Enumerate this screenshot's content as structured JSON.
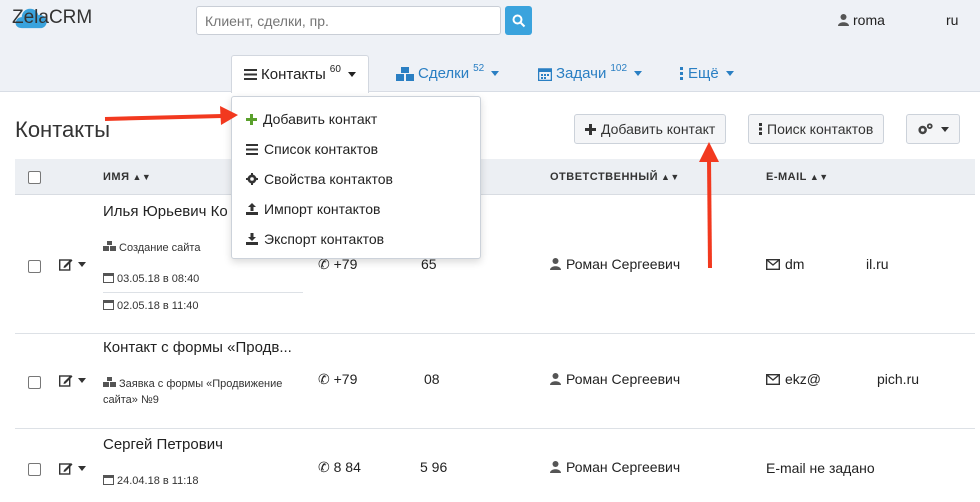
{
  "app": {
    "name": "ZelaCRM"
  },
  "search": {
    "placeholder": "Клиент, сделки, пр."
  },
  "user": {
    "name": "roma"
  },
  "lang": {
    "current": "ru"
  },
  "nav": {
    "contacts": {
      "label": "Контакты",
      "count": "60"
    },
    "deals": {
      "label": "Сделки",
      "count": "52"
    },
    "tasks": {
      "label": "Задачи",
      "count": "102"
    },
    "more": {
      "label": "Ещё"
    }
  },
  "dropdown": {
    "items": [
      {
        "label": "Добавить контакт",
        "icon": "plus-icon"
      },
      {
        "label": "Список контактов",
        "icon": "list-icon"
      },
      {
        "label": "Свойства контактов",
        "icon": "gear-icon"
      },
      {
        "label": "Импорт контактов",
        "icon": "upload-icon"
      },
      {
        "label": "Экспорт контактов",
        "icon": "download-icon"
      }
    ]
  },
  "page": {
    "title": "Контакты"
  },
  "toolbar": {
    "add_label": "Добавить контакт",
    "search_label": "Поиск контактов"
  },
  "table": {
    "headers": {
      "name": "ИМЯ",
      "responsible": "ОТВЕТСТВЕННЫЙ",
      "email": "E-MAIL"
    },
    "rows": [
      {
        "name": "Илья Юрьевич Ко",
        "deal": "Создание сайта",
        "date1": "03.05.18 в 08:40",
        "date2": "02.05.18 в 11:40",
        "phone_start": "+79",
        "phone_end": "65",
        "responsible": "Роман Сергеевич",
        "email_start": "dm",
        "email_end": "il.ru"
      },
      {
        "name": "Контакт с формы «Продв...",
        "deal_line1": "Заявка с формы «Продвижение",
        "deal_line2": "сайта» №9",
        "phone_start": "+79",
        "phone_end": "08",
        "responsible": "Роман Сергеевич",
        "email_start": "ekz@",
        "email_end": "pich.ru"
      },
      {
        "name": "Сергей Петрович",
        "date1": "24.04.18 в 11:18",
        "phone_start": "8 84",
        "phone_end": "5 96",
        "responsible": "Роман Сергеевич",
        "email_missing": "E-mail не задано"
      }
    ]
  },
  "colors": {
    "accent": "#3aa3dd",
    "link": "#2a7fc3",
    "arrow": "#f2391f",
    "add": "#5aa02c"
  }
}
